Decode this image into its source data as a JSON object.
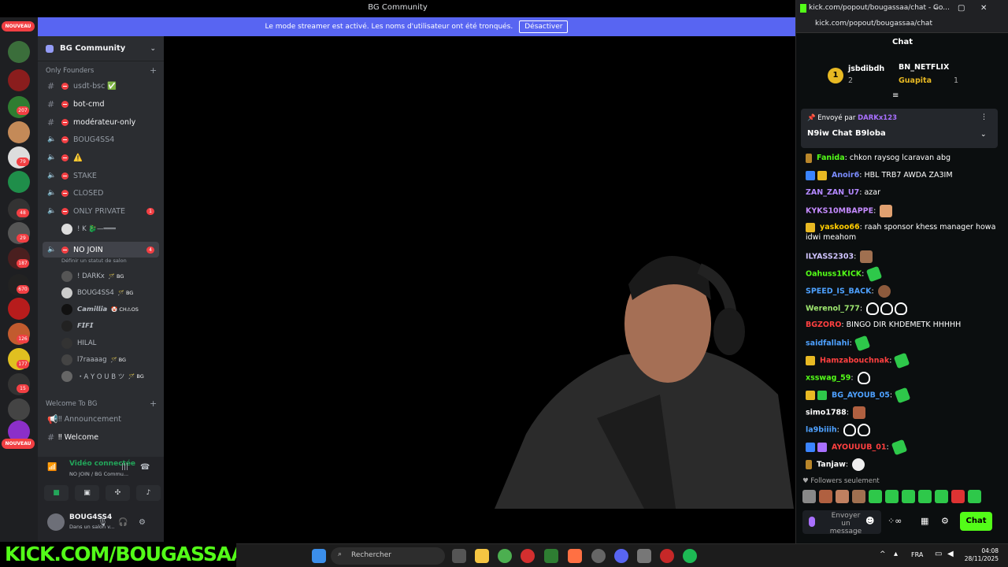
{
  "window": {
    "title": "BG Community",
    "streamer_banner_text": "Le mode streamer est activé. Les noms d'utilisateur ont été tronqués.",
    "streamer_banner_button": "Désactiver"
  },
  "rail": {
    "nouveau_top": "NOUVEAU",
    "nouveau_bottom": "NOUVEAU",
    "badges": [
      "1",
      "5",
      "2",
      "207",
      "1",
      "79",
      "8",
      "48",
      "29",
      "187",
      "670",
      "126",
      "177",
      "15"
    ]
  },
  "server": {
    "name": "BG Community",
    "categories": {
      "founders": "Only Founders",
      "welcome": "Welcome To BG"
    },
    "channels": [
      {
        "name": "usdt-bsc",
        "suffix": "✅"
      },
      {
        "name": "bot-cmd"
      },
      {
        "name": "modérateur-only"
      },
      {
        "name": "BOUG4SS4"
      },
      {
        "name": "⚠️"
      },
      {
        "name": "STAKE"
      },
      {
        "name": "CLOSED"
      },
      {
        "name": "ONLY PRIVATE",
        "badge": "1"
      },
      {
        "name": "! K 🐉—═══"
      },
      {
        "name": "NO JOIN",
        "badge": "4",
        "status": "Définir un statut de salon"
      }
    ],
    "members": [
      {
        "name": "! DARKx",
        "tag": "🪄 BG"
      },
      {
        "name": "BOUG4SS4",
        "tag": "🪄 BG"
      },
      {
        "name": "𝘾𝙖𝙢𝙞𝙡𝙡𝙞𝙖",
        "tag": "🤡 CH⚠OS"
      },
      {
        "name": "𝙁𝙄𝙁𝙄"
      },
      {
        "name": "HILAL"
      },
      {
        "name": "l7raaaag",
        "tag": "🪄 BG"
      },
      {
        "name": "・A Y O U B ツ",
        "tag": "🪄 BG"
      }
    ],
    "welcome_channels": [
      {
        "name": "‼ Announcement"
      },
      {
        "name": "‼ Welcome"
      }
    ]
  },
  "voice": {
    "status": "Vidéo connectée",
    "location": "NO JOIN / BG Commu..."
  },
  "user": {
    "name": "BOUG4SS4",
    "status": "Dans un salon v..."
  },
  "overlay": {
    "kick_text": "KICK.COM/BOUGASSAA"
  },
  "chat": {
    "window_title": "kick.com/popout/bougassaa/chat - Go...",
    "url": "kick.com/popout/bougassaa/chat",
    "header": "Chat",
    "leaderboard": [
      {
        "rank": "1",
        "name": "jsbdibdh",
        "count": "2"
      },
      {
        "rank": "2",
        "name": "BN_NETFLIX",
        "count": ""
      },
      {
        "rank": "3",
        "name": "Guapita",
        "count": "1"
      }
    ],
    "pinned": {
      "sent_by": "Envoyé par",
      "author": "DARKx123",
      "message": "N9iw Chat B9loba"
    },
    "messages": [
      {
        "user": "Fanida",
        "color": "#53fc18",
        "text": "chkon raysog lcaravan abg"
      },
      {
        "user": "Anoir6",
        "color": "#7b8cff",
        "text": "HBL TRB7 AWDA ZA3IM"
      },
      {
        "user": "ZAN_ZAN_U7",
        "color": "#b388ff",
        "text": "azar"
      },
      {
        "user": "KYKS10MBAPPE",
        "color": "#c58bff",
        "text": ""
      },
      {
        "user": "yaskoo66",
        "color": "#ffcc00",
        "text": "raah sponsor khess manager howa idwi meahom"
      },
      {
        "user": "ILYASS2303",
        "color": "#d0c4ff",
        "text": ""
      },
      {
        "user": "Oahuss1KICK",
        "color": "#53fc18",
        "text": ""
      },
      {
        "user": "SPEED_IS_BACK",
        "color": "#4ea1ff",
        "text": ""
      },
      {
        "user": "Werenol_777",
        "color": "#9fe870",
        "text": ""
      },
      {
        "user": "BGZORO",
        "color": "#ff4040",
        "text": "BINGO DIR KHDEMETK HHHHH"
      },
      {
        "user": "saidfallahi",
        "color": "#4ea1ff",
        "text": ""
      },
      {
        "user": "Hamzabouchnak",
        "color": "#ff4040",
        "text": ""
      },
      {
        "user": "xsswag_59",
        "color": "#53fc18",
        "text": ""
      },
      {
        "user": "BG_AYOUB_05",
        "color": "#4ea1ff",
        "text": ""
      },
      {
        "user": "simo1788",
        "color": "#ffffff",
        "text": ""
      },
      {
        "user": "la9biiih",
        "color": "#4ea1ff",
        "text": ""
      },
      {
        "user": "AYOUUUB_01",
        "color": "#ff4040",
        "text": ""
      },
      {
        "user": "Tanjaw",
        "color": "#ffffff",
        "text": ""
      }
    ],
    "followers_only": "Followers seulement",
    "input_placeholder": "Envoyer un message",
    "send_button": "Chat"
  },
  "taskbar": {
    "search": "Rechercher",
    "lang": "FRA",
    "time": "04:08",
    "date": "28/11/2025"
  }
}
